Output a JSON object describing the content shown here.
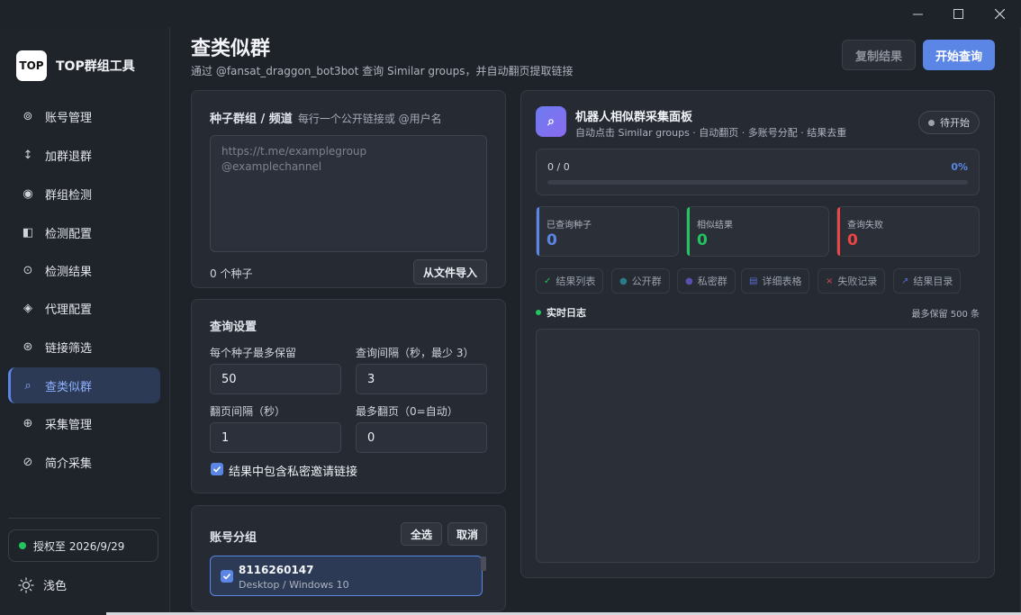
{
  "window": {
    "icons": [
      "minimize-icon",
      "maximize-icon",
      "close-icon"
    ]
  },
  "sidebar": {
    "logo_text": "TOP",
    "app_title": "TOP群组工具",
    "items": [
      {
        "label": "账号管理",
        "icon": "⊚"
      },
      {
        "label": "加群退群",
        "icon": "↕"
      },
      {
        "label": "群组检测",
        "icon": "◉"
      },
      {
        "label": "检测配置",
        "icon": "◧"
      },
      {
        "label": "检测结果",
        "icon": "⊙"
      },
      {
        "label": "代理配置",
        "icon": "◈"
      },
      {
        "label": "链接筛选",
        "icon": "⊛"
      },
      {
        "label": "查类似群",
        "icon": "⌕"
      },
      {
        "label": "采集管理",
        "icon": "⊕"
      },
      {
        "label": "简介采集",
        "icon": "⊘"
      }
    ],
    "active_index": 7,
    "license": "授权至 2026/9/29",
    "theme_label": "浅色"
  },
  "header": {
    "title": "查类似群",
    "subtitle": "通过 @fansat_draggon_bot3bot 查询 Similar groups，并自动翻页提取链接",
    "copy_button": "复制结果",
    "start_button": "开始查询"
  },
  "seed": {
    "title": "种子群组 / 频道",
    "hint": "每行一个公开链接或 @用户名",
    "placeholder_line1": "https://t.me/examplegroup",
    "placeholder_line2": "@examplechannel",
    "count": "0 个种子",
    "import_button": "从文件导入"
  },
  "settings": {
    "title": "查询设置",
    "max_keep_label": "每个种子最多保留",
    "max_keep_value": "50",
    "interval_label": "查询间隔（秒，最少 3）",
    "interval_value": "3",
    "page_interval_label": "翻页间隔（秒）",
    "page_interval_value": "1",
    "max_pages_label": "最多翻页（0=自动）",
    "max_pages_value": "0",
    "include_private_label": "结果中包含私密邀请链接",
    "include_private_checked": true
  },
  "accounts": {
    "title": "账号分组",
    "select_all": "全选",
    "cancel": "取消",
    "items": [
      {
        "id": "8116260147",
        "device": "Desktop / Windows 10",
        "checked": true
      }
    ]
  },
  "panel": {
    "icon": "⌕",
    "title": "机器人相似群采集面板",
    "subtitle": "自动点击 Similar groups · 自动翻页 · 多账号分配 · 结果去重",
    "status": "待开始",
    "progress_text": "0 / 0",
    "progress_percent_text": "0%",
    "progress_fraction": 0,
    "stats": [
      {
        "label": "已查询种子",
        "value": "0",
        "color": "#5b86e5"
      },
      {
        "label": "相似结果",
        "value": "0",
        "color": "#22c55e"
      },
      {
        "label": "查询失败",
        "value": "0",
        "color": "#ef4444"
      }
    ],
    "tabs": [
      {
        "label": "结果列表",
        "icon": "✓",
        "icon_color": "#22c55e"
      },
      {
        "label": "公开群",
        "icon": "●",
        "icon_color": "#2a7a8a"
      },
      {
        "label": "私密群",
        "icon": "●",
        "icon_color": "#5b4fb0"
      },
      {
        "label": "详细表格",
        "icon": "▤",
        "icon_color": "#5b6bd0"
      },
      {
        "label": "失败记录",
        "icon": "×",
        "icon_color": "#d04a5a"
      },
      {
        "label": "结果目录",
        "icon": "↗",
        "icon_color": "#5b6bd0"
      }
    ],
    "log_title": "实时日志",
    "log_keep": "最多保留 500 条"
  }
}
